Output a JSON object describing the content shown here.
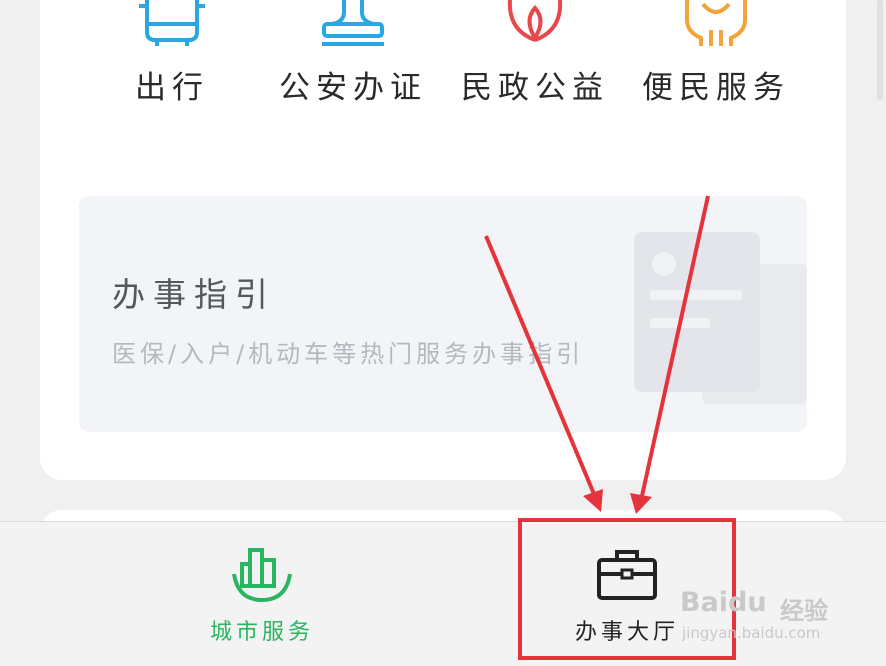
{
  "categories": [
    {
      "label": "出行",
      "icon": "bus-icon",
      "color": "#2aa7e0"
    },
    {
      "label": "公安办证",
      "icon": "stamp-icon",
      "color": "#2aa7e0"
    },
    {
      "label": "民政公益",
      "icon": "lotus-icon",
      "color": "#e8474b"
    },
    {
      "label": "便民服务",
      "icon": "hands-heart-icon",
      "color": "#f0a43a"
    }
  ],
  "guide": {
    "title": "办事指引",
    "subtitle": "医保/入户/机动车等热门服务办事指引"
  },
  "tabs": [
    {
      "label": "城市服务",
      "icon": "city-buildings-icon",
      "color": "#2ab561",
      "active": true
    },
    {
      "label": "办事大厅",
      "icon": "briefcase-icon",
      "color": "#222222",
      "active": false
    }
  ],
  "watermark": {
    "brand": "Baidu",
    "text": "经验",
    "url": "jingyan.baidu.com"
  },
  "annotation_color": "#e4333a"
}
